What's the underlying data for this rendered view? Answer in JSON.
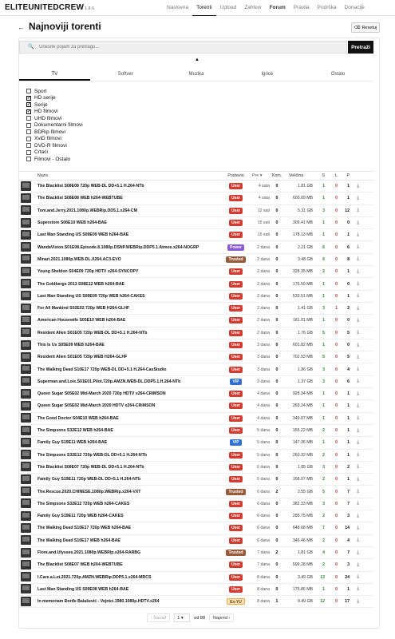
{
  "nav": {
    "brand": "ELITEUNITEDCREW",
    "version": "1.8.6",
    "links": [
      {
        "label": "Naslovna",
        "state": "normal"
      },
      {
        "label": "Torenti",
        "state": "active"
      },
      {
        "label": "Upload",
        "state": "normal"
      },
      {
        "label": "Zahtevi",
        "state": "normal"
      },
      {
        "label": "Forum",
        "state": "bold"
      },
      {
        "label": "Pravila",
        "state": "normal"
      },
      {
        "label": "Podrška",
        "state": "normal"
      },
      {
        "label": "Donacije",
        "state": "normal"
      }
    ]
  },
  "header": {
    "back_icon": "arrow-left-icon",
    "title": "Najnoviji torenti",
    "reset_label": "Resetuj"
  },
  "search": {
    "placeholder": "Unesite pojam za pretragu...",
    "button_label": "Pretraži"
  },
  "tabs": [
    {
      "label": "TV",
      "active": true
    },
    {
      "label": "Softver",
      "active": false
    },
    {
      "label": "Muzika",
      "active": false
    },
    {
      "label": "Igrice",
      "active": false
    },
    {
      "label": "Ostalo",
      "active": false
    }
  ],
  "categories": [
    {
      "label": "Sport",
      "checked": false
    },
    {
      "label": "HD serije",
      "checked": true
    },
    {
      "label": "Serije",
      "checked": true
    },
    {
      "label": "HD filmovi",
      "checked": true
    },
    {
      "label": "UHD filmovi",
      "checked": false
    },
    {
      "label": "Dokumentarni filmovi",
      "checked": false
    },
    {
      "label": "BDRip filmovi",
      "checked": false
    },
    {
      "label": "XviD filmovi",
      "checked": false
    },
    {
      "label": "DVD-R filmovi",
      "checked": false
    },
    {
      "label": "Crtaći",
      "checked": false
    },
    {
      "label": "Filmovi - Ostalo",
      "checked": false
    }
  ],
  "table": {
    "headers": {
      "name": "Naziv",
      "poster": "Postavio",
      "pre": "Pre",
      "kom": "Kom.",
      "size": "Veličina",
      "s": "S",
      "l": "L",
      "p": "P"
    },
    "badge_colors": {
      "User": "#d63a2e",
      "VIP": "#2f6fd0",
      "Ex-YU": "#f3a93c",
      "Trusted": "#9a5a3a",
      "Power": "#8a5ad0"
    },
    "rows": [
      {
        "name": "The Blacklist S08E08 720p WEB-DL DD+5.1 H.264-NTb",
        "poster": "User",
        "pre": "4 sata",
        "kom": "0",
        "size": "1.81 GB",
        "s": "1",
        "l": "0",
        "p": "1"
      },
      {
        "name": "The Blacklist S08E08 WEB h264-WEBTUBE",
        "poster": "User",
        "pre": "4 sata",
        "kom": "0",
        "size": "600.09 MB",
        "s": "1",
        "l": "0",
        "p": "1"
      },
      {
        "name": "Tom.and.Jerry.2021.1080p.WEBRip.DD5.1.x264-CM",
        "poster": "User",
        "pre": "12 sati",
        "kom": "0",
        "size": "5.31 GB",
        "s": "3",
        "l": "0",
        "p": "12"
      },
      {
        "name": "Superstore S06E10 WEB h264-BAE",
        "poster": "User",
        "pre": "15 sati",
        "kom": "0",
        "size": "309.41 MB",
        "s": "1",
        "l": "0",
        "p": "0"
      },
      {
        "name": "Last Man Standing US S09E09 WEB h264-BAE",
        "poster": "User",
        "pre": "15 sati",
        "kom": "0",
        "size": "178.13 MB",
        "s": "1",
        "l": "0",
        "p": "1"
      },
      {
        "name": "WandaVision.S01E08.Episode.8.1080p.DSNP.WEBRip.DDP5.1.Atmos.x264-NOGRP",
        "poster": "Power",
        "pre": "2 dana",
        "kom": "0",
        "size": "2.21 GB",
        "s": "6",
        "l": "0",
        "p": "6"
      },
      {
        "name": "Minari.2021.1080p.WEB-DL.X264.AC3-EVO",
        "poster": "Trusted",
        "pre": "2 dana",
        "kom": "0",
        "size": "3.48 GB",
        "s": "6",
        "l": "0",
        "p": "8"
      },
      {
        "name": "Young Sheldon S04E09 720p HDTV x264-SYNCOPY",
        "poster": "User",
        "pre": "2 dana",
        "kom": "0",
        "size": "328.35 MB",
        "s": "2",
        "l": "0",
        "p": "1"
      },
      {
        "name": "The Goldbergs 2013 S08E12 WEB h264-BAE",
        "poster": "User",
        "pre": "2 dana",
        "kom": "0",
        "size": "176.59 MB",
        "s": "1",
        "l": "0",
        "p": "0"
      },
      {
        "name": "Last Man Standing US S09E09 720p WEB h264-CAKES",
        "poster": "User",
        "pre": "2 dana",
        "kom": "0",
        "size": "533.51 MB",
        "s": "1",
        "l": "0",
        "p": "1"
      },
      {
        "name": "For All Mankind S02E02 720p WEB H264-GLHF",
        "poster": "User",
        "pre": "2 dana",
        "kom": "0",
        "size": "1.41 GB",
        "s": "3",
        "l": "1",
        "p": "2"
      },
      {
        "name": "American Housewife S05E10 WEB h264-BAE",
        "poster": "User",
        "pre": "2 dana",
        "kom": "0",
        "size": "181.91 MB",
        "s": "1",
        "l": "0",
        "p": "0"
      },
      {
        "name": "Resident Alien S01E05 720p WEB-DL DD+5.1 H.264-NTb",
        "poster": "User",
        "pre": "2 dana",
        "kom": "0",
        "size": "1.76 GB",
        "s": "5",
        "l": "0",
        "p": "5"
      },
      {
        "name": "This Is Us S05E09 WEB h264-BAE",
        "poster": "User",
        "pre": "3 dana",
        "kom": "0",
        "size": "601.82 MB",
        "s": "1",
        "l": "0",
        "p": "0"
      },
      {
        "name": "Resident Alien S01E05 720p WEB H264-GLHF",
        "poster": "User",
        "pre": "3 dana",
        "kom": "0",
        "size": "702.93 MB",
        "s": "5",
        "l": "0",
        "p": "5"
      },
      {
        "name": "The Walking Dead S10E17 720p WEB-DL DD+5.1 H.264-CasStudio",
        "poster": "User",
        "pre": "3 dana",
        "kom": "0",
        "size": "1.86 GB",
        "s": "3",
        "l": "0",
        "p": "4"
      },
      {
        "name": "Superman.and.Lois.S01E01.Pilot.720p.AMZN.WEB-DL.DDP5.1.H.264-NTb",
        "poster": "VIP",
        "pre": "3 dana",
        "kom": "0",
        "size": "1.37 GB",
        "s": "3",
        "l": "0",
        "p": "6"
      },
      {
        "name": "Queen Sugar S05E02 Mid-March 2020 720p HDTV x264-CRiMSON",
        "poster": "User",
        "pre": "4 dana",
        "kom": "0",
        "size": "928.34 MB",
        "s": "1",
        "l": "0",
        "p": "1"
      },
      {
        "name": "Queen Sugar S05E02 Mid-March 2020 HDTV x264-CRiMSON",
        "poster": "User",
        "pre": "4 dana",
        "kom": "0",
        "size": "269.24 MB",
        "s": "1",
        "l": "0",
        "p": "1"
      },
      {
        "name": "The Good Doctor S04E10 WEB h264-BAE",
        "poster": "User",
        "pre": "4 dana",
        "kom": "0",
        "size": "349.87 MB",
        "s": "1",
        "l": "0",
        "p": "1"
      },
      {
        "name": "The Simpsons S32E12 WEB h264-BAE",
        "poster": "User",
        "pre": "5 dana",
        "kom": "0",
        "size": "155.22 MB",
        "s": "2",
        "l": "0",
        "p": "1"
      },
      {
        "name": "Family Guy S19E11 WEB h264-BAE",
        "poster": "VIP",
        "pre": "5 dana",
        "kom": "0",
        "size": "147.36 MB",
        "s": "1",
        "l": "0",
        "p": "1"
      },
      {
        "name": "The Simpsons S32E12 720p WEB-DL DD+5.1 H.264-NTb",
        "poster": "User",
        "pre": "5 dana",
        "kom": "0",
        "size": "260.32 MB",
        "s": "2",
        "l": "0",
        "p": "1"
      },
      {
        "name": "The Blacklist S08E07 720p WEB-DL DD+5.1 H.264-NTb",
        "poster": "User",
        "pre": "5 dana",
        "kom": "0",
        "size": "1.85 GB",
        "s": "3",
        "l": "0",
        "p": "2"
      },
      {
        "name": "Family Guy S19E11 720p WEB-DL DD+5.1 H.264-NTb",
        "poster": "User",
        "pre": "5 dana",
        "kom": "0",
        "size": "168.07 MB",
        "s": "2",
        "l": "0",
        "p": "1"
      },
      {
        "name": "The.Rescue.2020.CHINESE.1080p.WEBRip.x264-VXT",
        "poster": "Trusted",
        "pre": "6 dana",
        "kom": "2",
        "size": "2.55 GB",
        "s": "5",
        "l": "0",
        "p": "7"
      },
      {
        "name": "The Simpsons S32E12 720p WEB h264-CAKES",
        "poster": "User",
        "pre": "6 dana",
        "kom": "0",
        "size": "382.33 MB",
        "s": "3",
        "l": "0",
        "p": "7"
      },
      {
        "name": "Family Guy S19E11 720p WEB h264-CAKES",
        "poster": "User",
        "pre": "6 dana",
        "kom": "0",
        "size": "285.75 MB",
        "s": "2",
        "l": "0",
        "p": "3"
      },
      {
        "name": "The Walking Dead S10E17 720p WEB h264-BAE",
        "poster": "User",
        "pre": "6 dana",
        "kom": "0",
        "size": "648.68 MB",
        "s": "7",
        "l": "0",
        "p": "14"
      },
      {
        "name": "The Walking Dead S10E17 WEB h264-BAE",
        "poster": "User",
        "pre": "6 dana",
        "kom": "0",
        "size": "346.46 MB",
        "s": "2",
        "l": "0",
        "p": "4"
      },
      {
        "name": "Flora.and.Ulysses.2021.1080p.WEBRip.x264-RARBG",
        "poster": "Trusted",
        "pre": "7 dana",
        "kom": "2",
        "size": "1.81 GB",
        "s": "4",
        "l": "0",
        "p": "7"
      },
      {
        "name": "The Blacklist S08E07 WEB h264-WEBTUBE",
        "poster": "User",
        "pre": "7 dana",
        "kom": "0",
        "size": "599.28 MB",
        "s": "2",
        "l": "0",
        "p": "3"
      },
      {
        "name": "I.Care.a.Lot.2021.720p.AMZN.WEBRip.DDP5.1.x264-MRCS",
        "poster": "User",
        "pre": "8 dana",
        "kom": "0",
        "size": "3.49 GB",
        "s": "13",
        "l": "0",
        "p": "24"
      },
      {
        "name": "Last Man Standing US S09E08 WEB h264-BAE",
        "poster": "User",
        "pre": "8 dana",
        "kom": "0",
        "size": "175.86 MB",
        "s": "1",
        "l": "0",
        "p": "1"
      },
      {
        "name": "In memoriam Đorđe Balašević - Vojnici.1980.1080p.HDTV.x264",
        "poster": "Ex-YU",
        "pre": "8 dana",
        "kom": "1",
        "size": "9.49 GB",
        "s": "12",
        "l": "0",
        "p": "17"
      }
    ]
  },
  "pagination": {
    "prev_label": "Nazad",
    "page": "1",
    "of_label": "od 88",
    "next_label": "Napred"
  }
}
